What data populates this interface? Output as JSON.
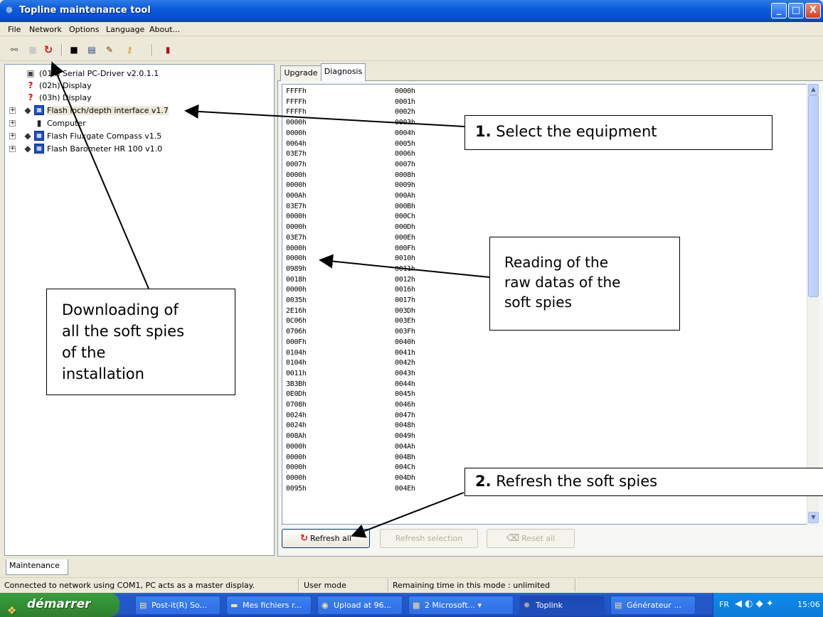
{
  "window": {
    "title": "Topline maintenance tool",
    "min": "_",
    "max": "□",
    "close": "X"
  },
  "menu": [
    "File",
    "Network",
    "Options",
    "Language",
    "About..."
  ],
  "toolbar_icons": [
    "network-icon",
    "device-icon",
    "refresh-icon",
    "save-icon",
    "export-icon",
    "tools-icon",
    "key-icon",
    "device-red-icon"
  ],
  "tree": {
    "items": [
      {
        "label": "(01h) Serial PC-Driver v2.0.1.1",
        "icon": "pc-icon",
        "expand": ""
      },
      {
        "label": "(02h) Display",
        "icon": "question-icon",
        "expand": ""
      },
      {
        "label": "(03h) Display",
        "icon": "question-icon",
        "expand": ""
      },
      {
        "label": "Flash loch/depth interface  v1.7",
        "icon": "module-icon",
        "expand": "+"
      },
      {
        "label": "Computer",
        "icon": "computer-icon",
        "expand": "+"
      },
      {
        "label": "Flash Fluxgate Compass v1.5",
        "icon": "module-icon",
        "expand": "+"
      },
      {
        "label": "Flash Barometer HR 100 v1.0",
        "icon": "module-icon",
        "expand": "+"
      }
    ]
  },
  "tabs": [
    "Upgrade",
    "Diagnosis"
  ],
  "rows": [
    [
      "FFFFh",
      "0000h"
    ],
    [
      "FFFFh",
      "0001h"
    ],
    [
      "FFFFh",
      "0002h"
    ],
    [
      "0000h",
      "0003h"
    ],
    [
      "0000h",
      "0004h"
    ],
    [
      "0064h",
      "0005h"
    ],
    [
      "03E7h",
      "0006h"
    ],
    [
      "0007h",
      "0007h"
    ],
    [
      "0000h",
      "0008h"
    ],
    [
      "0000h",
      "0009h"
    ],
    [
      "000Ah",
      "000Ah"
    ],
    [
      "03E7h",
      "000Bh"
    ],
    [
      "0000h",
      "000Ch"
    ],
    [
      "0000h",
      "000Dh"
    ],
    [
      "03E7h",
      "000Eh"
    ],
    [
      "0000h",
      "000Fh"
    ],
    [
      "0000h",
      "0010h"
    ],
    [
      "0989h",
      "0011h"
    ],
    [
      "0018h",
      "0012h"
    ],
    [
      "0000h",
      "0016h"
    ],
    [
      "0035h",
      "0017h"
    ],
    [
      "2E16h",
      "003Dh"
    ],
    [
      "0C06h",
      "003Eh"
    ],
    [
      "0706h",
      "003Fh"
    ],
    [
      "000Fh",
      "0040h"
    ],
    [
      "0104h",
      "0041h"
    ],
    [
      "0104h",
      "0042h"
    ],
    [
      "0011h",
      "0043h"
    ],
    [
      "3B3Bh",
      "0044h"
    ],
    [
      "0E0Dh",
      "0045h"
    ],
    [
      "0708h",
      "0046h"
    ],
    [
      "0024h",
      "0047h"
    ],
    [
      "0024h",
      "0048h"
    ],
    [
      "008Ah",
      "0049h"
    ],
    [
      "0000h",
      "004Ah"
    ],
    [
      "0000h",
      "004Bh"
    ],
    [
      "0000h",
      "004Ch"
    ],
    [
      "0000h",
      "004Dh"
    ],
    [
      "0095h",
      "004Eh"
    ]
  ],
  "buttons": {
    "refresh_all": "Refresh all",
    "refresh_selection": "Refresh selection",
    "reset_all": "Reset all"
  },
  "bottom_tab": "Maintenance",
  "status": {
    "connection": "Connected to network using COM1, PC acts as a master display.",
    "mode": "User mode",
    "remaining": "Remaining time in this mode : unlimited"
  },
  "taskbar": {
    "start": "démarrer",
    "tasks": [
      "Post-it(R) So...",
      "Mes fichiers r...",
      "Upload at 96...",
      "2 Microsoft...",
      "Toplink",
      "Générateur ..."
    ],
    "lang": "FR",
    "clock": "15:06"
  },
  "callouts": {
    "c1_num": "1.",
    "c1_text": "Select the equipment",
    "c2_l1": "Reading of the",
    "c2_l2": "raw datas of the",
    "c2_l3": "soft spies",
    "c3_l1": "Downloading of",
    "c3_l2": "all the soft spies",
    "c3_l3": "of the",
    "c3_l4": "installation",
    "c4_num": "2.",
    "c4_text": "Refresh the soft spies"
  }
}
